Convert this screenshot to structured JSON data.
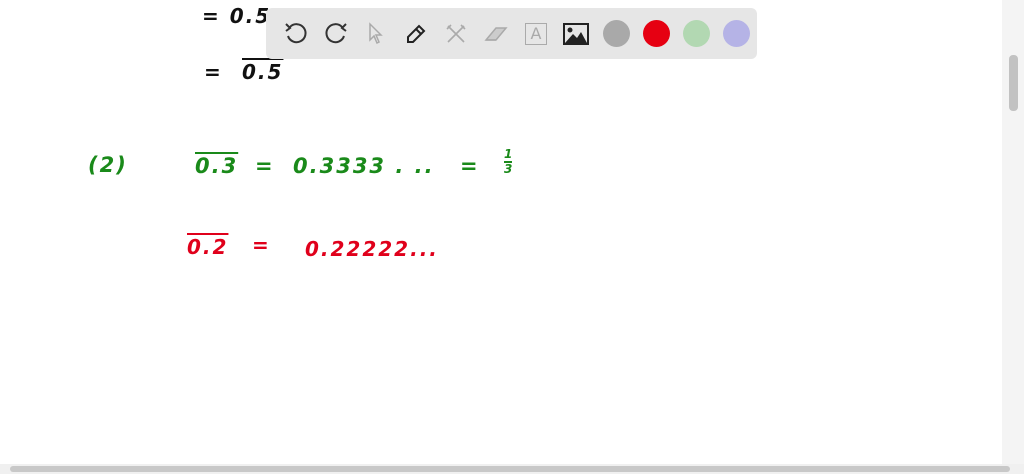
{
  "canvas": {
    "line1": "= 0.5",
    "line2_eq": "=",
    "line2_val": "0.5",
    "label2": "(2)",
    "green_lhs": "0.3",
    "green_eq1": "=",
    "green_mid": "0.3333 . ..",
    "green_eq2": "=",
    "green_num": "1",
    "green_den": "3",
    "red_lhs": "0.2",
    "red_eq": "=",
    "red_rhs": "0.22222..."
  },
  "toolbar": {
    "tools": [
      "undo-icon",
      "redo-icon",
      "select-icon",
      "pen-icon",
      "tools-icon",
      "eraser-icon",
      "text-icon",
      "image-icon"
    ],
    "text_glyph": "A",
    "colors": [
      "#a9a9a9",
      "#e60012",
      "#b2d8b2",
      "#b5b3e6"
    ]
  }
}
